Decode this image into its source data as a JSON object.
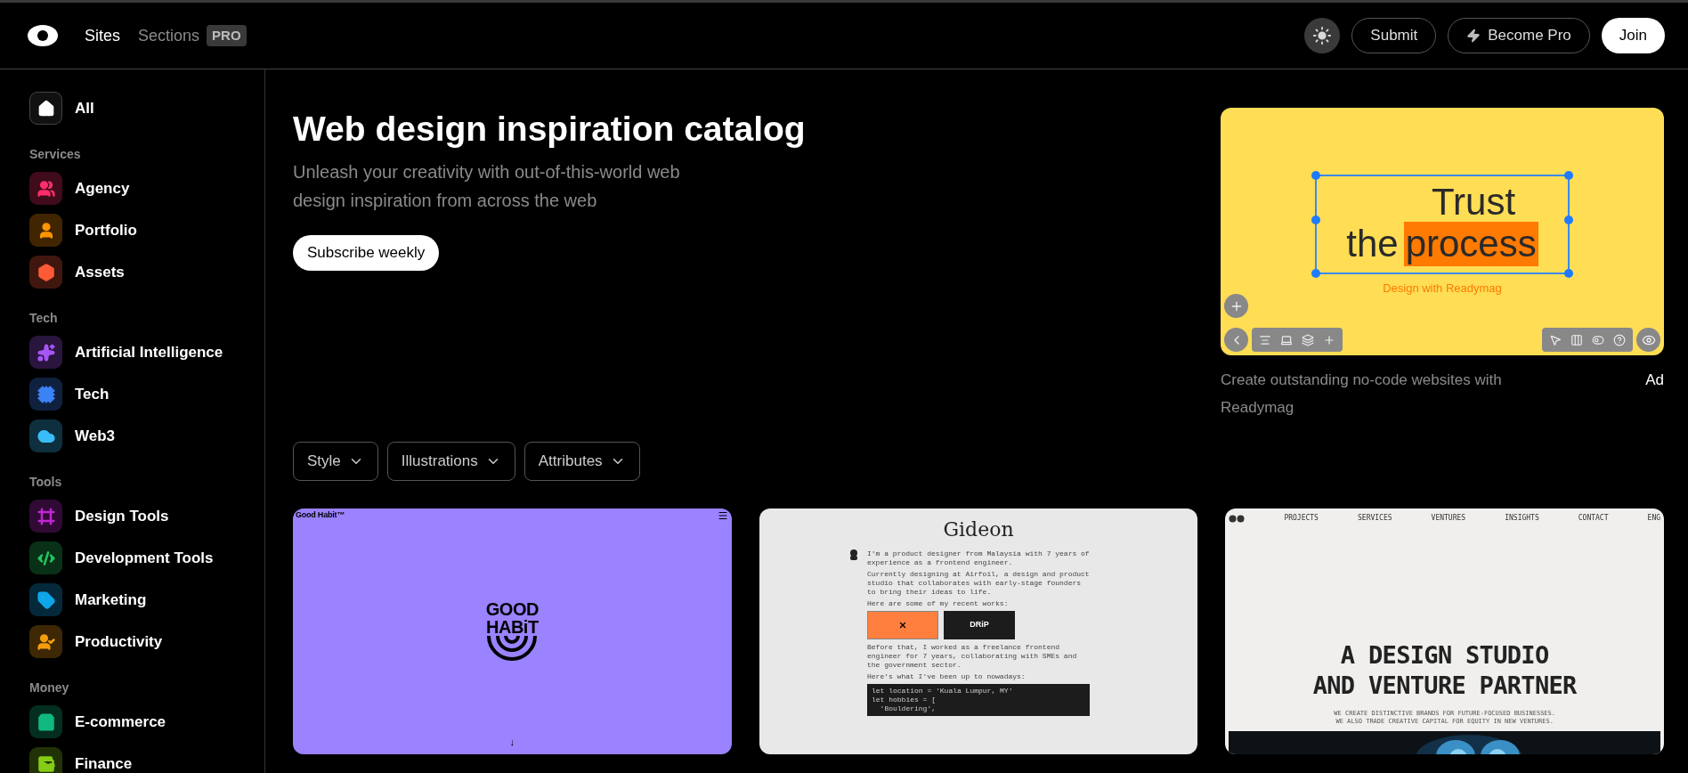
{
  "header": {
    "nav": [
      {
        "label": "Sites",
        "selected": true
      },
      {
        "label": "Sections",
        "selected": false,
        "badge": "PRO"
      }
    ],
    "buttons": [
      {
        "kind": "theme"
      },
      {
        "kind": "outline",
        "label": "Submit"
      },
      {
        "kind": "bolt",
        "label": "Become Pro"
      },
      {
        "kind": "solid",
        "label": "Join"
      }
    ]
  },
  "sidebar": {
    "all": {
      "label": "All",
      "selected": true
    },
    "sections": [
      {
        "heading": "Services",
        "items": [
          {
            "label": "Agency",
            "color": "#ff2d6b",
            "selected": false
          },
          {
            "label": "Portfolio",
            "color": "#ff9500",
            "selected": false
          },
          {
            "label": "Assets",
            "color": "#ff5a36",
            "selected": false
          }
        ]
      },
      {
        "heading": "Tech",
        "items": [
          {
            "label": "Artificial Intelligence",
            "color": "#a855f7",
            "selected": false
          },
          {
            "label": "Tech",
            "color": "#3b82f6",
            "selected": false
          },
          {
            "label": "Web3",
            "color": "#38bdf8",
            "selected": false
          }
        ]
      },
      {
        "heading": "Tools",
        "items": [
          {
            "label": "Design Tools",
            "color": "#c026d3",
            "selected": false
          },
          {
            "label": "Development Tools",
            "color": "#22c55e",
            "selected": false
          },
          {
            "label": "Marketing",
            "color": "#0ea5e9",
            "selected": false
          },
          {
            "label": "Productivity",
            "color": "#f59e0b",
            "selected": false
          }
        ]
      },
      {
        "heading": "Money",
        "items": [
          {
            "label": "E-commerce",
            "color": "#10b981",
            "selected": false
          },
          {
            "label": "Finance",
            "color": "#84cc16",
            "selected": false
          }
        ]
      }
    ]
  },
  "hero": {
    "title": "Web design inspiration catalog",
    "subtitle": "Unleash your creativity with out-of-this-world web design inspiration from across the web",
    "button": "Subscribe weekly"
  },
  "ad": {
    "line_1": "Trust",
    "line_2a": "the",
    "line_2b": "process",
    "tagline": "Design with Readymag",
    "caption": "Create outstanding no-code websites with Readymag",
    "badge": "Ad"
  },
  "filters": [
    "Style",
    "Illustrations",
    "Attributes"
  ],
  "sites": [
    {
      "kind": "goodhabit",
      "brand": "Good Habit™",
      "logo_1": "GOOD",
      "logo_2": "HABiT",
      "arrow": "↓"
    },
    {
      "kind": "gideon",
      "name": "Gideon",
      "paragraphs": [
        "I'm a product designer from Malaysia with 7 years of experience as a frontend engineer.",
        "Currently designing at Airfoil, a design and product studio that collaborates with early-stage founders to bring their ideas to life.",
        "Here are some of my recent works:"
      ],
      "work": "DRiP",
      "paragraphs_2": [
        "Before that, I worked as a freelance frontend engineer for 7 years, collaborating with SMEs and the government sector.",
        "Here's what I've been up to nowadays:"
      ],
      "code": [
        "let location = 'Kuala Lumpur, MY'",
        "let hobbies = [",
        "  'Bouldering',"
      ]
    },
    {
      "kind": "studio",
      "nav": [
        "PROJECTS",
        "SERVICES",
        "VENTURES",
        "INSIGHTS",
        "CONTACT",
        "ENG"
      ],
      "headline_1": "A DESIGN STUDIO",
      "headline_2": "AND VENTURE PARTNER",
      "sub_1": "WE CREATE DISTINCTIVE BRANDS FOR FUTURE-FOCUSED BUSINESSES.",
      "sub_2": "WE ALSO TRADE CREATIVE CAPITAL FOR EQUITY IN NEW VENTURES."
    }
  ]
}
